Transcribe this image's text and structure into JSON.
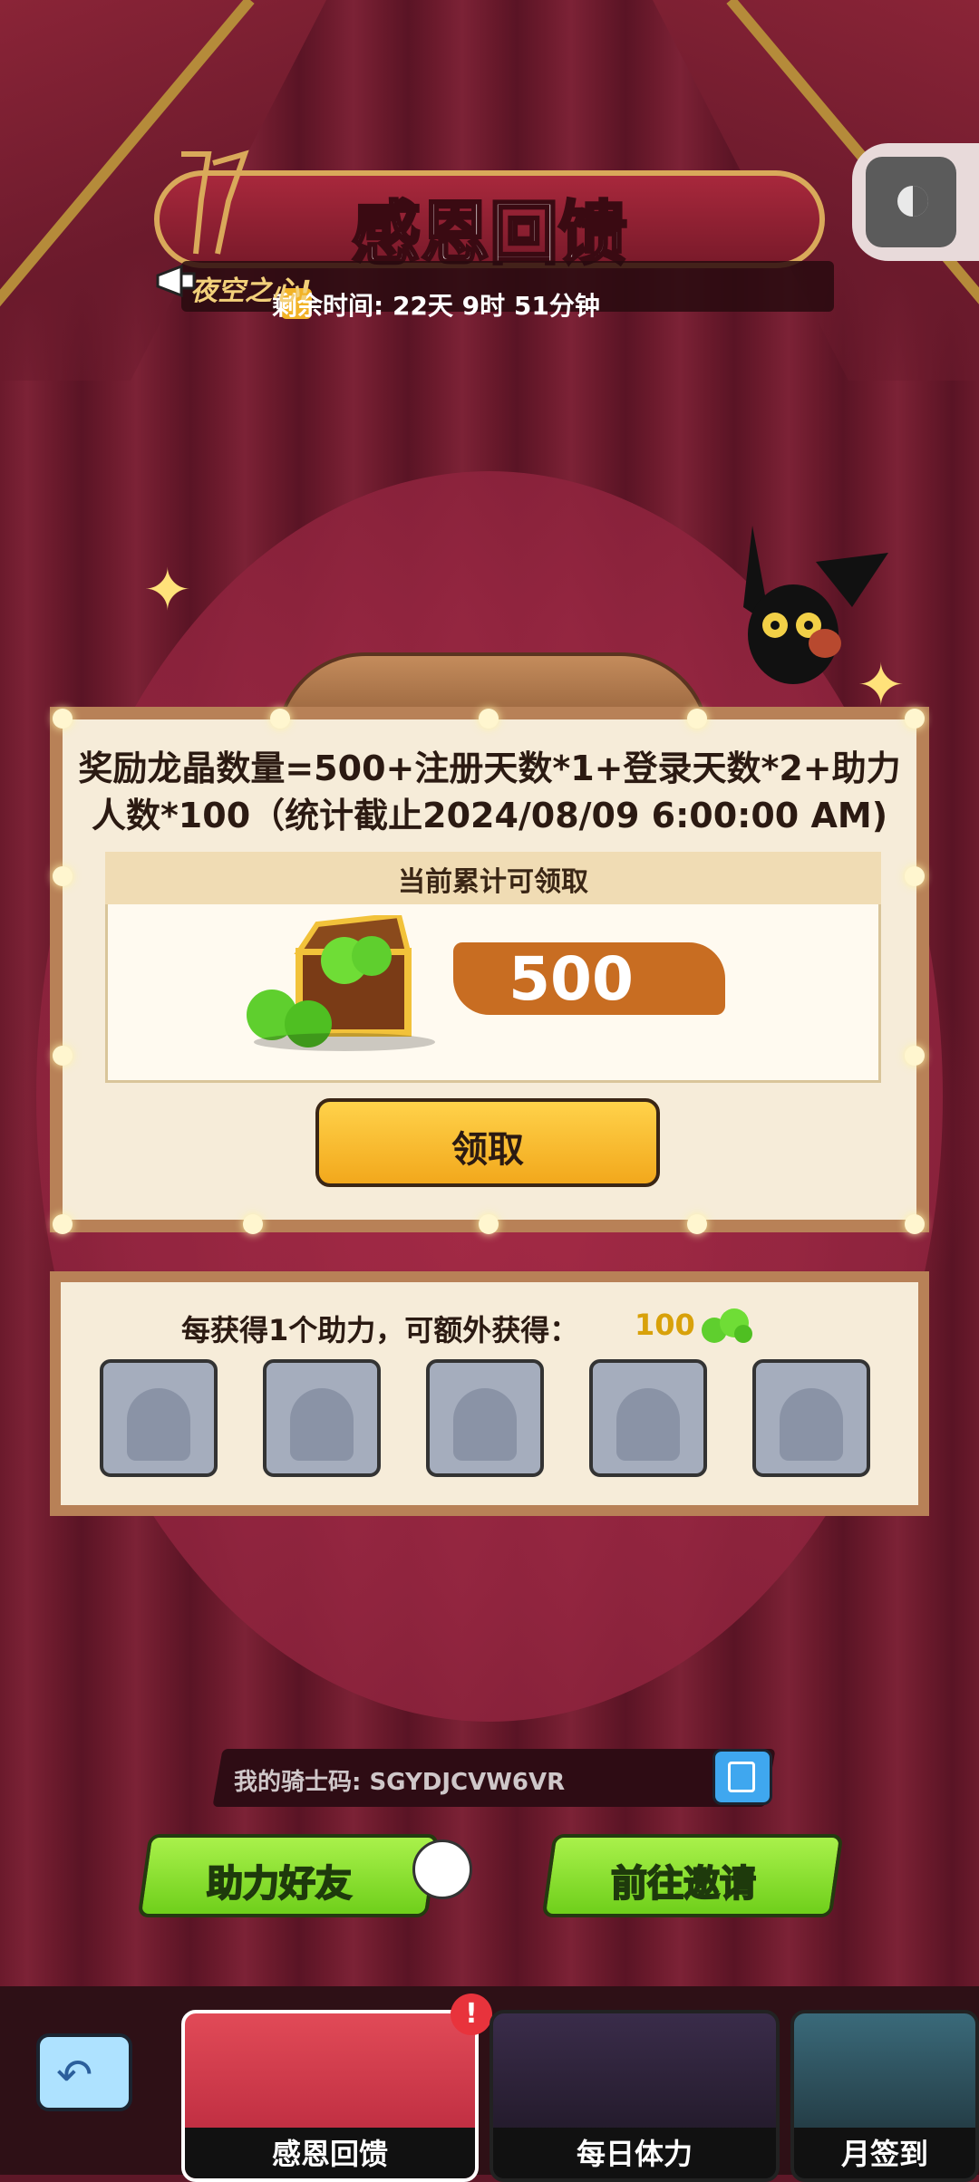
{
  "header": {
    "title": "感恩回馈",
    "marquee": "夜空之心!",
    "timer": "剩余时间: 22天 9时 51分钟"
  },
  "main": {
    "formula": "奖励龙晶数量=500+注册天数*1+登录天数*2+助力人数*100（统计截止2024/08/09 6:00:00 AM)",
    "reward_card_title": "当前累计可领取",
    "reward_amount": "500",
    "claim_label": "领取"
  },
  "helpers": {
    "text": "每获得1个助力，可额外获得：",
    "bonus": "100",
    "slot_count": 5
  },
  "knight_code": "我的骑士码: SGYDJCVW6VR",
  "buttons": {
    "assist_friend": "助力好友",
    "invite": "前往邀请"
  },
  "nav": {
    "tabs": [
      {
        "label": "感恩回馈",
        "active": true,
        "alert": "!"
      },
      {
        "label": "每日体力",
        "active": false
      },
      {
        "label": "月签到",
        "active": false
      }
    ]
  },
  "colors": {
    "accent_green": "#8fe534",
    "accent_yellow": "#f7c23a",
    "reward_orange": "#c86d22",
    "board_frame": "#b88157"
  },
  "icons": [
    "champagne-glasses-icon",
    "megaphone-icon",
    "clock-icon",
    "theme-toggle-icon",
    "treasure-chest-icon",
    "gem-icon",
    "avatar-placeholder-icon",
    "copy-icon",
    "back-arrow-icon"
  ]
}
